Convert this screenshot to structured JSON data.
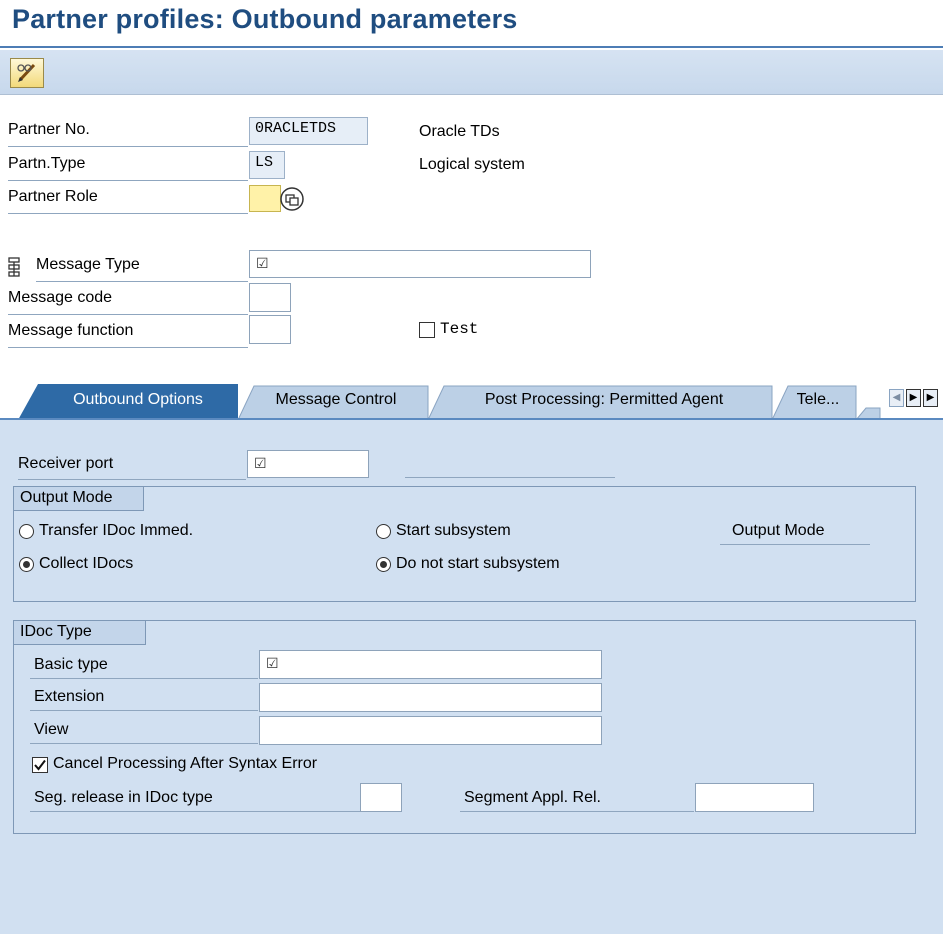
{
  "window": {
    "title": "Partner profiles: Outbound parameters"
  },
  "toolbar": {
    "edit_icon": "pencil-glasses-icon"
  },
  "header": {
    "partner_no": {
      "label": "Partner No.",
      "value": "0RACLETDS",
      "description": "Oracle TDs"
    },
    "partn_type": {
      "label": "Partn.Type",
      "value": "LS",
      "description": "Logical system"
    },
    "partner_role": {
      "label": "Partner Role",
      "value": ""
    },
    "message_type": {
      "label": "Message Type",
      "value": "☑"
    },
    "message_code": {
      "label": "Message code",
      "value": ""
    },
    "message_function": {
      "label": "Message function",
      "value": ""
    },
    "test": {
      "label": "Test",
      "checked": false
    }
  },
  "tabs": [
    {
      "label": "Outbound Options",
      "active": true
    },
    {
      "label": "Message Control",
      "active": false
    },
    {
      "label": "Post Processing: Permitted Agent",
      "active": false
    },
    {
      "label": "Tele...",
      "active": false
    }
  ],
  "outbound": {
    "receiver_port": {
      "label": "Receiver port",
      "value": "☑"
    },
    "output_mode": {
      "title": "Output Mode",
      "transfer_immed": "Transfer IDoc Immed.",
      "collect": "Collect IDocs",
      "start_subsystem": "Start subsystem",
      "do_not_start": "Do not start subsystem",
      "output_mode_label": "Output Mode",
      "selected_transfer": "collect",
      "selected_subsystem": "do_not_start"
    },
    "idoc_type": {
      "title": "IDoc Type",
      "basic_type": {
        "label": "Basic type",
        "value": "☑"
      },
      "extension": {
        "label": "Extension",
        "value": ""
      },
      "view": {
        "label": "View",
        "value": ""
      },
      "cancel_processing": {
        "label": "Cancel Processing After Syntax Error",
        "checked": true
      },
      "seg_release": {
        "label": "Seg. release in IDoc type",
        "value": ""
      },
      "segment_appl_rel": {
        "label": "Segment Appl. Rel.",
        "value": ""
      }
    }
  },
  "colors": {
    "title": "#1f4d80",
    "panel": "#d1e0f1",
    "active_tab": "#2e6aa6",
    "required_field": "#fff2a8"
  }
}
